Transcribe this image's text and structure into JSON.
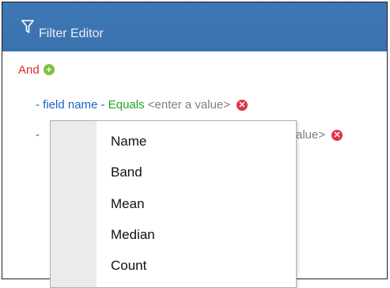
{
  "window": {
    "title": "Filter Editor"
  },
  "filter": {
    "group_operator": "And",
    "add_icon": "plus-circle-icon",
    "conditions": [
      {
        "prefix": "- ",
        "field": "field name",
        "dash": " - ",
        "operator": "Equals",
        "value": "<enter a value>",
        "remove_icon": "remove-icon"
      },
      {
        "prefix": "- ",
        "value_visible": "alue>",
        "remove_icon": "remove-icon"
      }
    ]
  },
  "field_dropdown": {
    "options": [
      "Name",
      "Band",
      "Mean",
      "Median",
      "Count"
    ]
  },
  "colors": {
    "titlebar": "#3c76b3",
    "group_operator": "#e3262f",
    "field": "#1a63c4",
    "operator": "#21a621",
    "value": "#7e7e7e",
    "add": "#7cc242",
    "remove": "#e0334a"
  }
}
